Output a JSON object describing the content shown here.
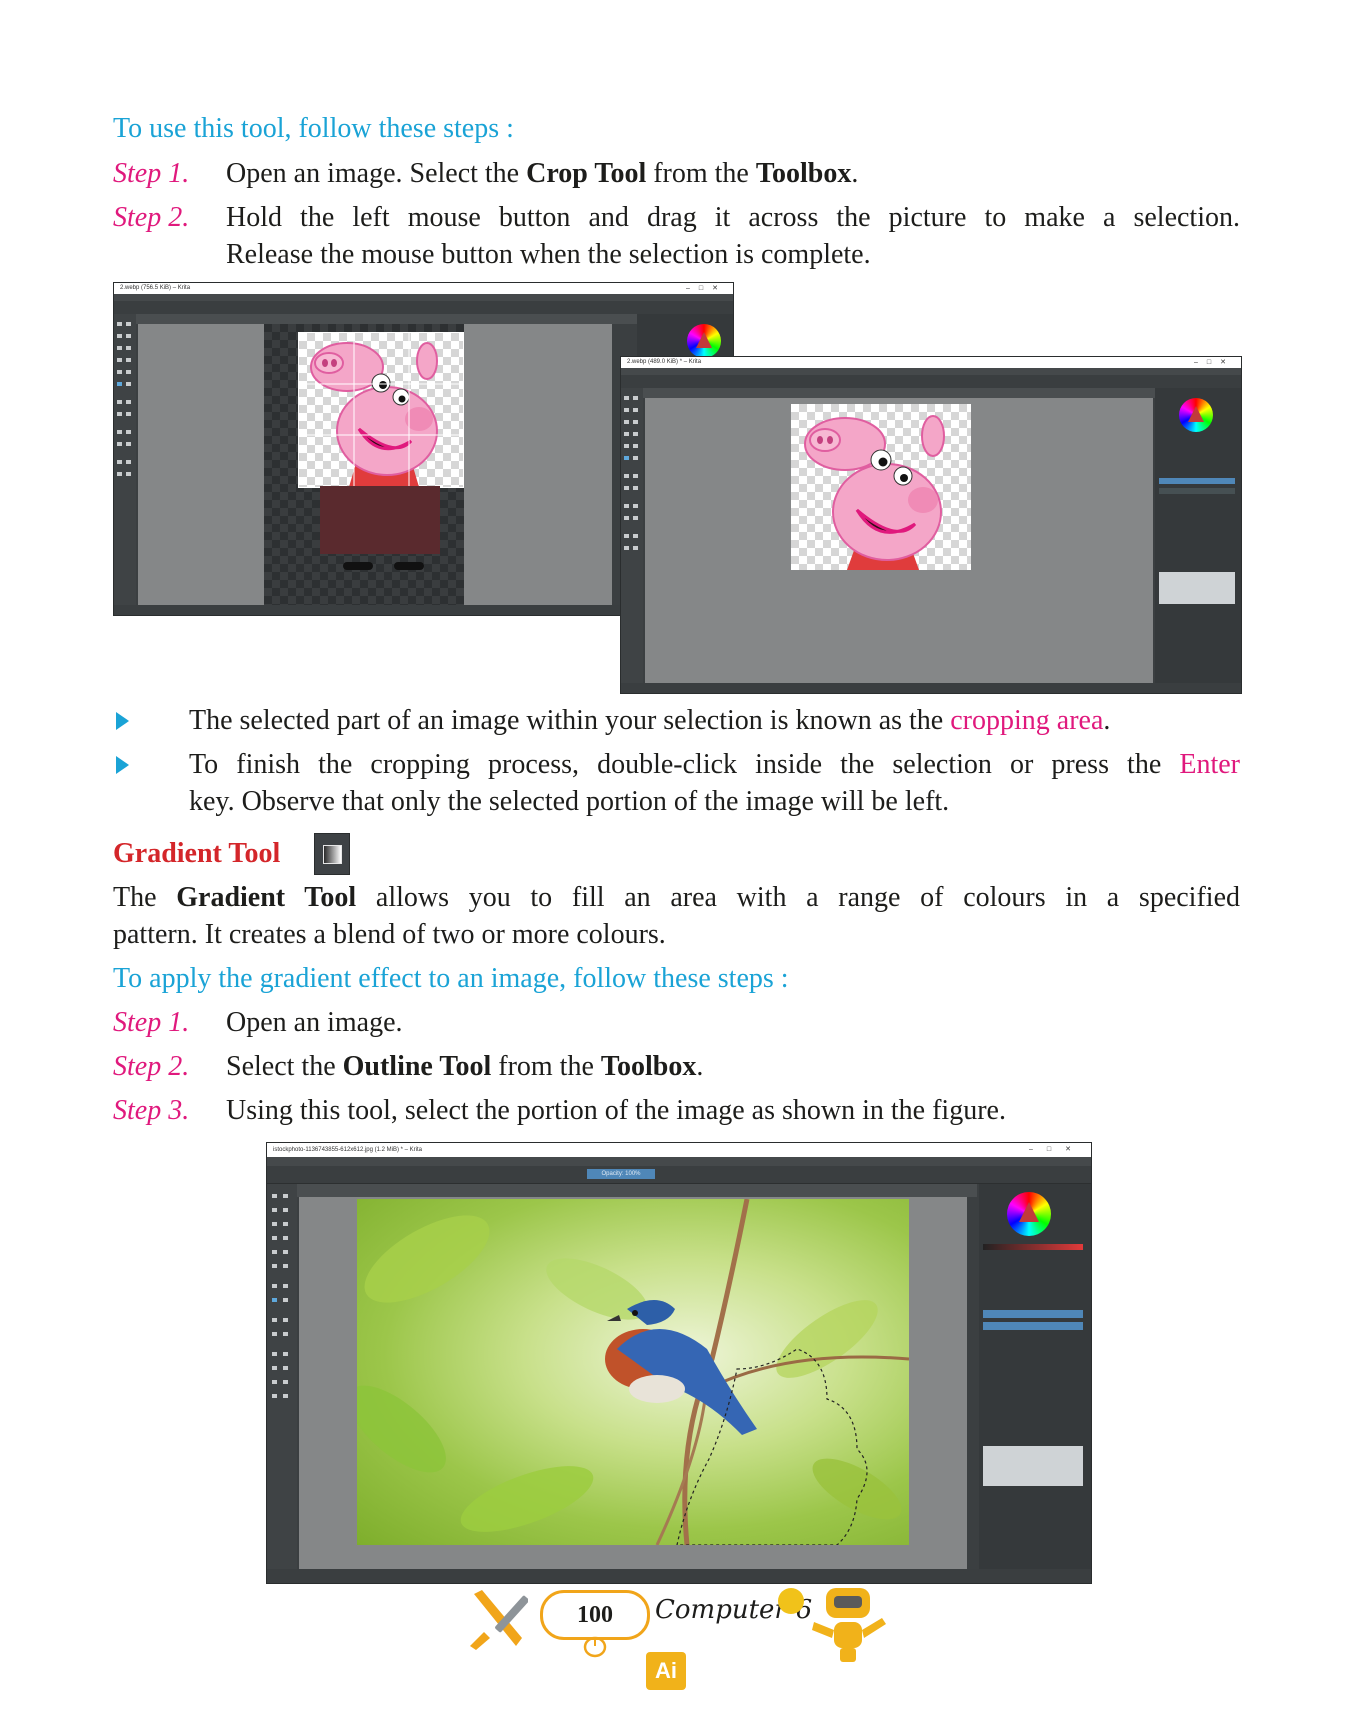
{
  "intro": "To use this tool, follow these steps :",
  "crop_steps": [
    {
      "label": "Step 1.",
      "pre": "Open an image. Select the ",
      "b1": "Crop Tool",
      "mid": " from the ",
      "b2": "Toolbox",
      "post": "."
    },
    {
      "label": "Step 2.",
      "line1": "Hold the left mouse button and drag it across the picture to make a selection.",
      "line2": "Release the mouse button when the selection is complete."
    }
  ],
  "screenshot1": {
    "title": "2.webp (756.5 KiB) – Krita"
  },
  "screenshot2": {
    "title": "2.webp (489.0 KiB) * – Krita"
  },
  "bullets": [
    {
      "pre": "The selected part of an image within your selection is known as the ",
      "highlight": "cropping area",
      "post": "."
    },
    {
      "pre": "To finish the cropping process, double-click inside the selection or press the ",
      "highlight": "Enter",
      "line2": "key. Observe that only the selected portion of the image will be left."
    }
  ],
  "gradient": {
    "heading": "Gradient Tool",
    "para_line1": {
      "pre": "The ",
      "b": "Gradient Tool",
      "post": " allows you to fill an area with a range of colours in a specified"
    },
    "para_line2": "pattern. It creates a blend of two or more colours.",
    "intro": "To apply the gradient effect to an image, follow these steps :",
    "steps": [
      {
        "label": "Step 1.",
        "text": "Open an image."
      },
      {
        "label": "Step 2.",
        "pre": "Select the ",
        "b1": "Outline Tool",
        "mid": " from the ",
        "b2": "Toolbox",
        "post": "."
      },
      {
        "label": "Step 3.",
        "text": "Using this tool, select the portion of the image as shown in the figure."
      }
    ]
  },
  "screenshot3": {
    "title": "istockphoto-1136743855-612x612.jpg (1.2 MiB) * – Krita",
    "opacity": "Opacity: 100%"
  },
  "footer": {
    "page": "100",
    "subject": "Computer-6",
    "badge": "Ai"
  },
  "colors": {
    "heading_blue": "#1aa3d6",
    "step_pink": "#e0197d",
    "heading_red": "#d4262a"
  }
}
